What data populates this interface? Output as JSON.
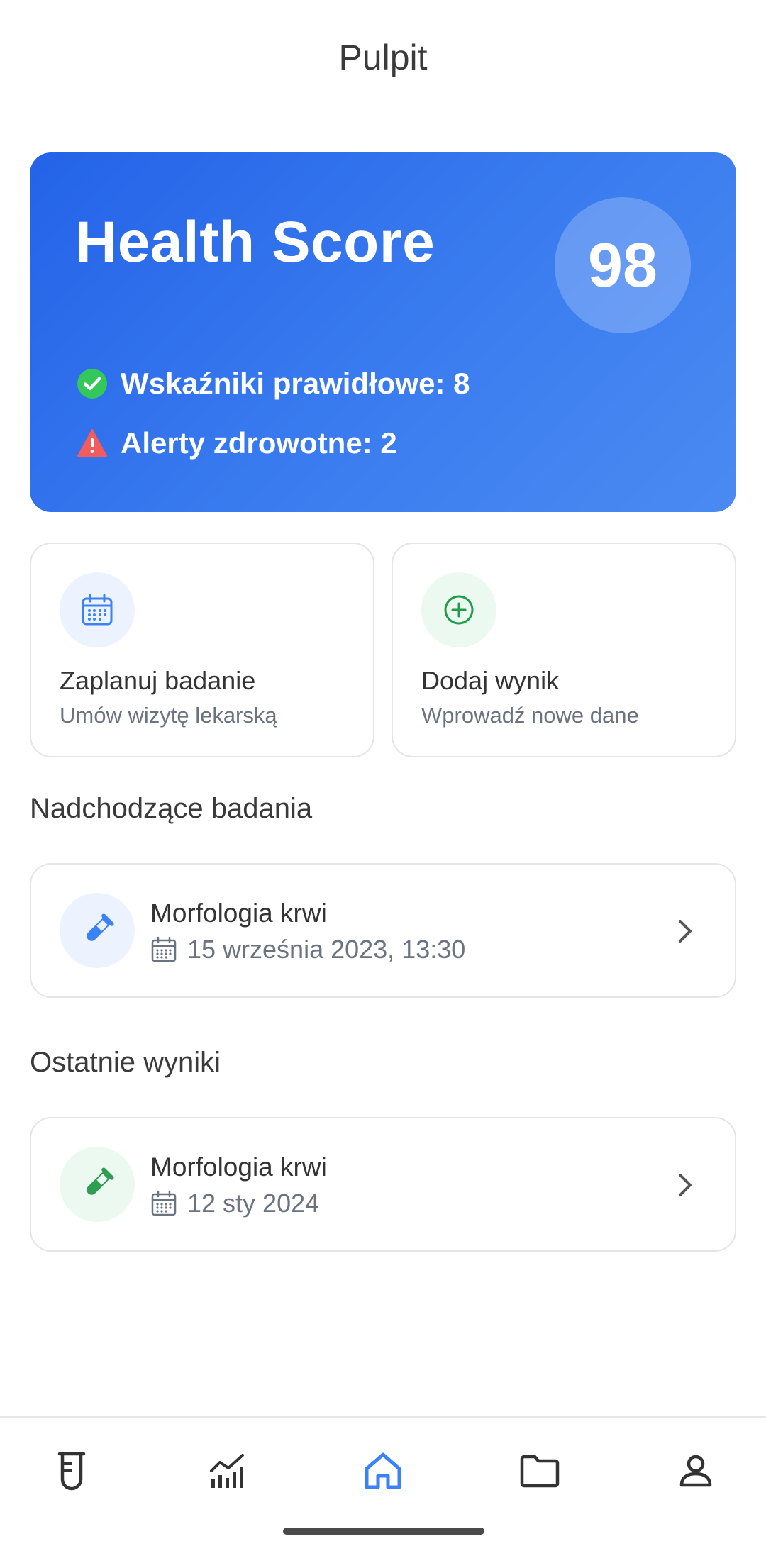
{
  "header": {
    "title": "Pulpit"
  },
  "health": {
    "title": "Health Score",
    "score": "98",
    "normal_indicators": "Wskaźniki prawidłowe: 8",
    "alerts": "Alerty zdrowotne: 2"
  },
  "actions": [
    {
      "title": "Zaplanuj badanie",
      "subtitle": "Umów wizytę lekarską",
      "icon": "calendar-icon"
    },
    {
      "title": "Dodaj wynik",
      "subtitle": "Wprowadź nowe dane",
      "icon": "plus-circle-icon"
    }
  ],
  "upcoming": {
    "section_title": "Nadchodzące badania",
    "items": [
      {
        "title": "Morfologia krwi",
        "date": "15 września 2023, 13:30",
        "icon": "test-tube-icon"
      }
    ]
  },
  "recent": {
    "section_title": "Ostatnie wyniki",
    "items": [
      {
        "title": "Morfologia krwi",
        "date": "12 sty 2024",
        "icon": "test-tube-icon"
      }
    ]
  },
  "bottom_nav": {
    "items": [
      {
        "name": "tests",
        "icon": "beaker-icon"
      },
      {
        "name": "stats",
        "icon": "chart-icon"
      },
      {
        "name": "home",
        "icon": "home-icon",
        "active": true
      },
      {
        "name": "files",
        "icon": "folder-icon"
      },
      {
        "name": "profile",
        "icon": "user-icon"
      }
    ]
  },
  "colors": {
    "primary": "#2563eb",
    "success": "#22c55e",
    "warning": "#ef4444",
    "muted": "#6b7280"
  }
}
